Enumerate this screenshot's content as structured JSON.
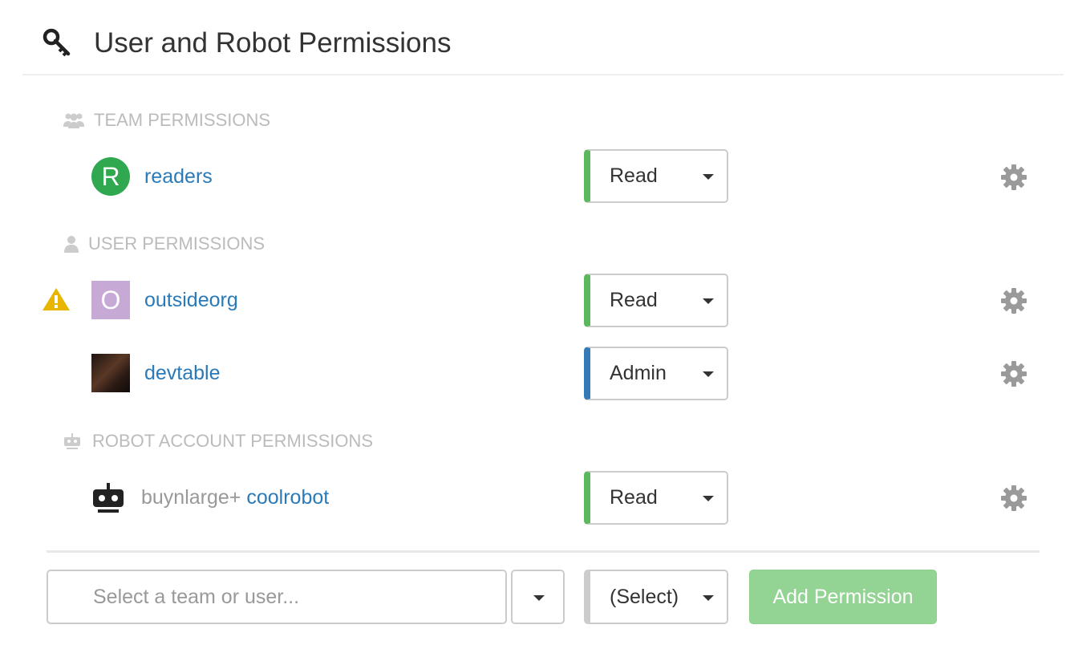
{
  "header": {
    "title": "User and Robot Permissions",
    "icon": "key-icon"
  },
  "sections": {
    "team": {
      "label": "TEAM PERMISSIONS",
      "icon": "users-icon"
    },
    "user": {
      "label": "USER PERMISSIONS",
      "icon": "user-icon"
    },
    "robot": {
      "label": "ROBOT ACCOUNT PERMISSIONS",
      "icon": "robot-icon"
    }
  },
  "team_rows": [
    {
      "avatar_letter": "R",
      "avatar_color": "#2fa84f",
      "name": "readers",
      "role": "Read",
      "role_color": "#5cb85c"
    }
  ],
  "user_rows": [
    {
      "avatar_letter": "O",
      "avatar_color": "#c7a9d6",
      "name": "outsideorg",
      "role": "Read",
      "role_color": "#5cb85c",
      "warning": true
    },
    {
      "avatar_letter": "",
      "avatar_color": "#3a2620",
      "name": "devtable",
      "role": "Admin",
      "role_color": "#337ab7",
      "warning": false
    }
  ],
  "robot_rows": [
    {
      "prefix": "buynlarge+",
      "name": "coolrobot",
      "role": "Read",
      "role_color": "#5cb85c"
    }
  ],
  "add_form": {
    "entity_placeholder": "Select a team or user...",
    "role_placeholder": "(Select)",
    "submit_label": "Add Permission"
  },
  "colors": {
    "link": "#2a7ab8",
    "warning": "#e8b600",
    "gear": "#9a9a9a",
    "add_button": "#93d393"
  }
}
